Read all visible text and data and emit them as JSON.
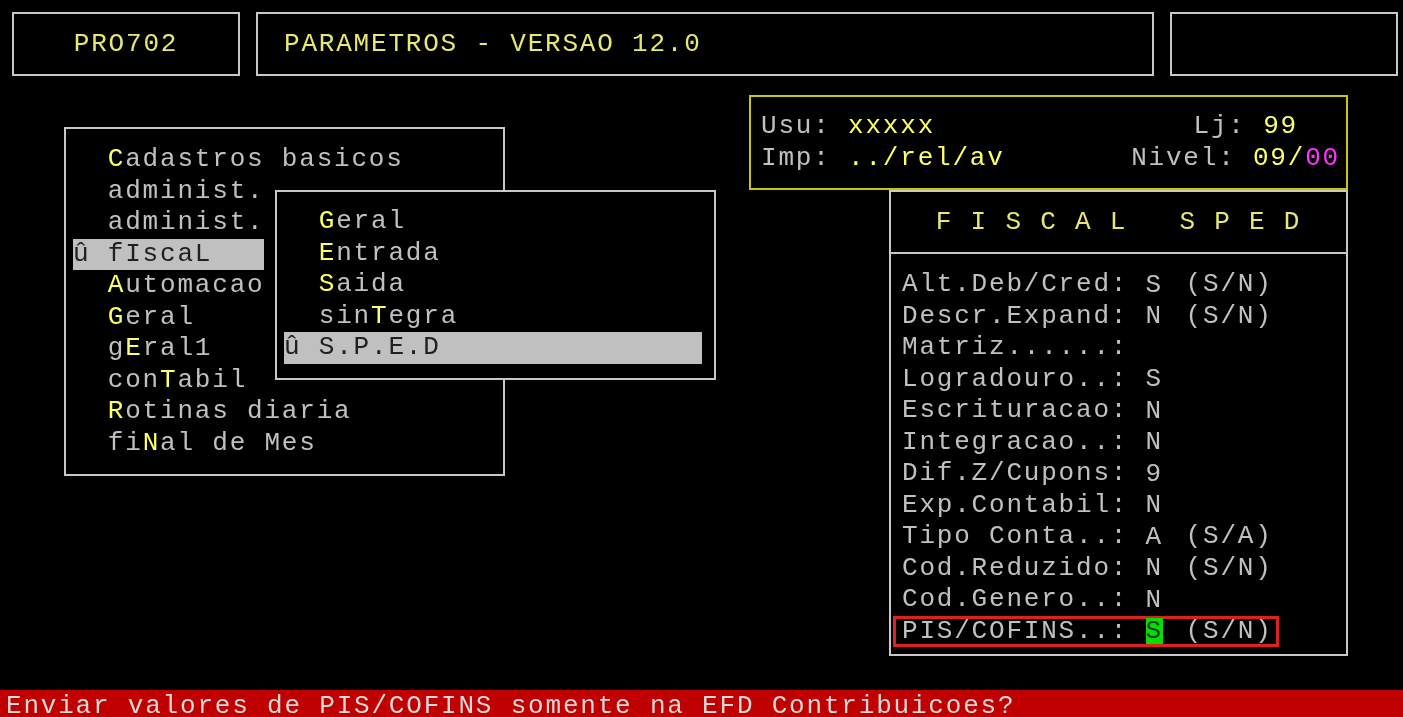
{
  "header": {
    "program_code": "PRO702",
    "title": "PARAMETROS - VERSAO 12.0"
  },
  "main_menu": {
    "items": [
      {
        "hotkey": "C",
        "label_end": "adastros basicos",
        "selected": false
      },
      {
        "label_start": "administ.",
        "selected": false
      },
      {
        "label_start": "administ.",
        "selected": false
      },
      {
        "label_start": "fIscaL",
        "selected": true,
        "marker": "û"
      },
      {
        "hotkey": "A",
        "label_end": "utomacao",
        "selected": false
      },
      {
        "hotkey": "G",
        "label_end": "eral",
        "selected": false
      },
      {
        "label_start": "g",
        "hotkey": "E",
        "label_end": "ral1",
        "selected": false
      },
      {
        "label_start": "con",
        "hotkey": "T",
        "label_end": "abil",
        "selected": false
      },
      {
        "hotkey": "R",
        "label_end": "otinas diaria",
        "selected": false
      },
      {
        "label_start": "fi",
        "hotkey": "N",
        "label_end": "al de Mes",
        "selected": false
      }
    ]
  },
  "submenu": {
    "items": [
      {
        "hotkey": "G",
        "label_end": "eral",
        "selected": false
      },
      {
        "hotkey": "E",
        "label_end": "ntrada",
        "selected": false
      },
      {
        "hotkey": "S",
        "label_end": "aida",
        "selected": false
      },
      {
        "label_start": "sin",
        "hotkey": "T",
        "label_end": "egra",
        "selected": false
      },
      {
        "label_start": "S.P.E.D",
        "selected": true,
        "marker": "û"
      }
    ]
  },
  "session_info": {
    "rows": [
      [
        {
          "label": "Usu:",
          "value_parts": [
            {
              "text": "xxxxx",
              "color": "#ffff66"
            }
          ]
        },
        {
          "label": "Lj:",
          "value_parts": [
            {
              "text": "99",
              "color": "#ffff66"
            }
          ]
        }
      ],
      [
        {
          "label": "Imp:",
          "value_parts": [
            {
              "text": "../rel/av",
              "color": "#ffff66"
            }
          ]
        },
        {
          "label": "Nivel:",
          "value_parts": [
            {
              "text": "09/",
              "color": "#ffff66"
            },
            {
              "text": "00",
              "color": "#ff33ff"
            }
          ]
        }
      ]
    ]
  },
  "fiscal_panel": {
    "title": "F I S C A L   S P E D",
    "fields": [
      {
        "label": "Alt.Deb/Cred:",
        "value": "S",
        "hint": "(S/N)",
        "focused": false,
        "annotated": false
      },
      {
        "label": "Descr.Expand:",
        "value": "N",
        "hint": "(S/N)",
        "focused": false,
        "annotated": false
      },
      {
        "label": "Matriz......:",
        "focused": false,
        "annotated": false
      },
      {
        "label": "Logradouro..:",
        "value": "S",
        "focused": false,
        "annotated": false
      },
      {
        "label": "Escrituracao:",
        "value": "N",
        "focused": false,
        "annotated": false
      },
      {
        "label": "Integracao..:",
        "value": "N",
        "focused": false,
        "annotated": false
      },
      {
        "label": "Dif.Z/Cupons:",
        "value": "9",
        "focused": false,
        "annotated": false
      },
      {
        "label": "Exp.Contabil:",
        "value": "N",
        "focused": false,
        "annotated": false
      },
      {
        "label": "Tipo Conta..:",
        "value": "A",
        "hint": "(S/A)",
        "focused": false,
        "annotated": false
      },
      {
        "label": "Cod.Reduzido:",
        "value": "N",
        "hint": "(S/N)",
        "focused": false,
        "annotated": false
      },
      {
        "label": "Cod.Genero..:",
        "value": "N",
        "focused": false,
        "annotated": false
      },
      {
        "label": "PIS/COFINS..:",
        "value": "S",
        "hint": "(S/N)",
        "focused": true,
        "annotated": true
      }
    ]
  },
  "status_bar": {
    "message": "Enviar valores de PIS/COFINS somente na EFD Contribuicoes?"
  }
}
